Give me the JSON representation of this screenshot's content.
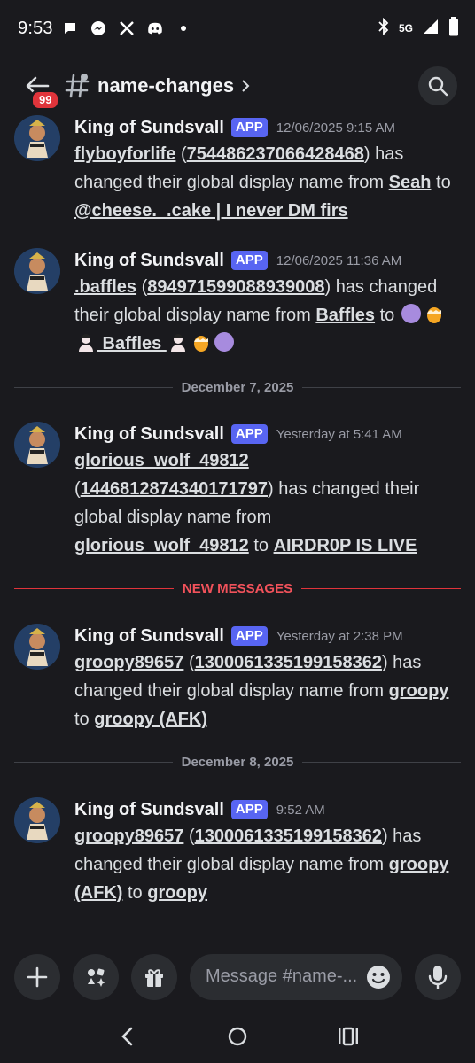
{
  "status_bar": {
    "time": "9:53",
    "network": "5G",
    "left_icons": [
      "chat-bubble-icon",
      "messenger-icon",
      "x-icon",
      "discord-icon",
      "dot-icon"
    ],
    "right_icons": [
      "bluetooth-icon",
      "signal-icon",
      "battery-icon"
    ]
  },
  "header": {
    "back_badge": "99",
    "channel_name": "name-changes"
  },
  "messages": [
    {
      "author": "King of Sundsvall",
      "tag": "APP",
      "timestamp": "12/06/2025 9:15 AM",
      "user": "flyboyforlife",
      "user_id": "754486237066428468",
      "old_name": "Seah",
      "new_name": "@cheese._.cake | I never DM firs"
    },
    {
      "author": "King of Sundsvall",
      "tag": "APP",
      "timestamp": "12/06/2025 11:36 AM",
      "user": ".baffles",
      "user_id": "894971599088939008",
      "old_name": "Baffles",
      "new_name": " Baffles "
    },
    {
      "divider": "December 7, 2025"
    },
    {
      "author": "King of Sundsvall",
      "tag": "APP",
      "timestamp": "Yesterday at 5:41 AM",
      "user": "glorious_wolf_49812",
      "user_id": "1446812874340171797",
      "old_name": "glorious_wolf_49812",
      "new_name": "AIRDR0P IS LIVE"
    },
    {
      "new_messages_divider": "NEW MESSAGES"
    },
    {
      "author": "King of Sundsvall",
      "tag": "APP",
      "timestamp": "Yesterday at 2:38 PM",
      "user": "groopy89657",
      "user_id": "1300061335199158362",
      "old_name": "groopy",
      "new_name": "groopy (AFK)"
    },
    {
      "divider": "December 8, 2025"
    },
    {
      "author": "King of Sundsvall",
      "tag": "APP",
      "timestamp": "9:52 AM",
      "user": "groopy89657",
      "user_id": "1300061335199158362",
      "old_name": "groopy (AFK)",
      "new_name": "groopy"
    }
  ],
  "text": {
    "has": "has",
    "changed_global": "changed their global display name from",
    "has_changed_their": "has changed their",
    "global_display_name_from": "global display name from",
    "to": "to"
  },
  "composer": {
    "placeholder": "Message #name-..."
  },
  "colors": {
    "background": "#1a1a1e",
    "app_tag": "#5865f2",
    "new_messages": "#f2525b",
    "badge": "#e0343b"
  }
}
